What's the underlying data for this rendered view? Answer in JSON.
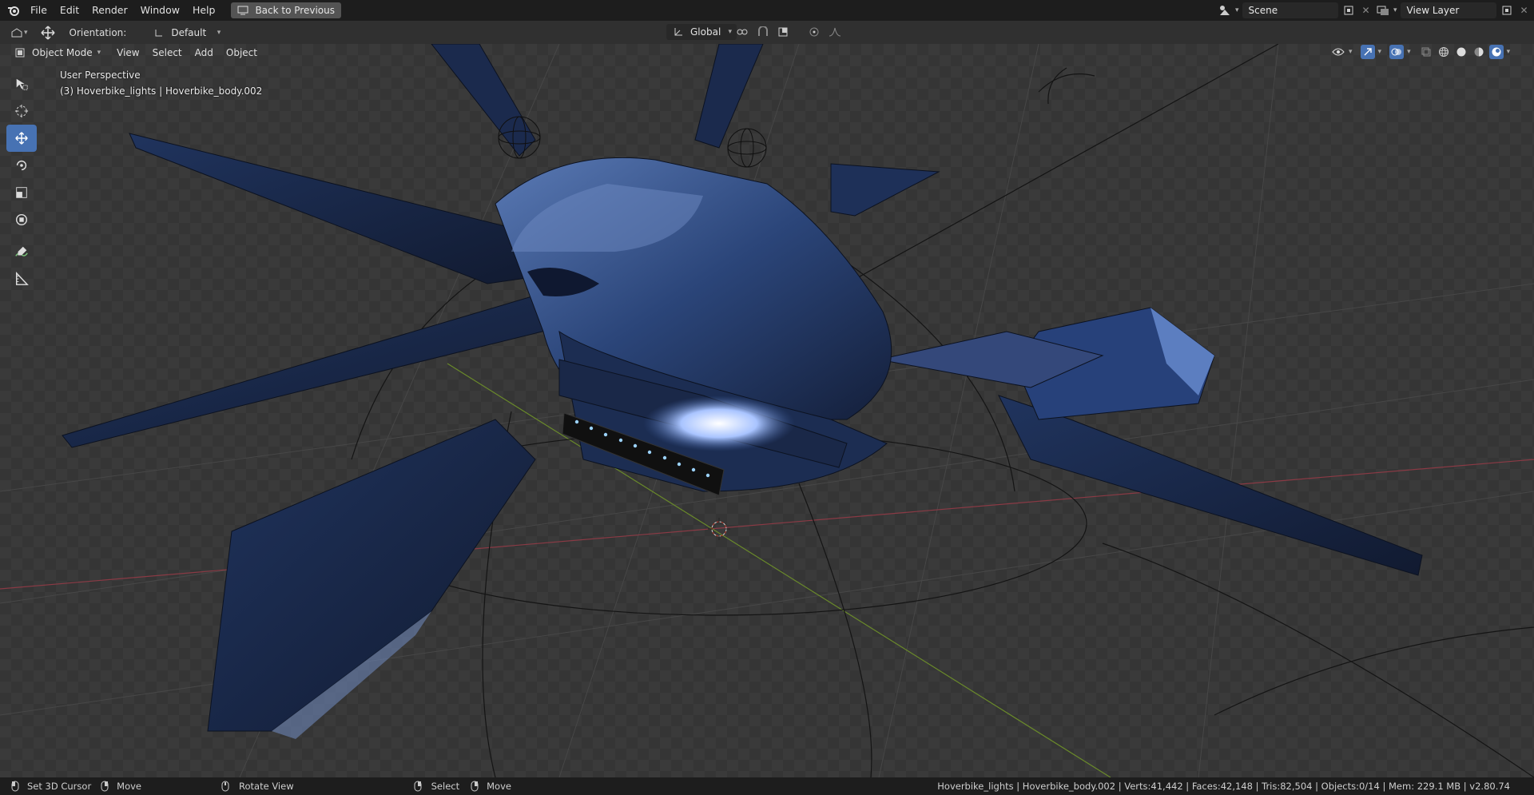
{
  "menu": {
    "file": "File",
    "edit": "Edit",
    "render": "Render",
    "window": "Window",
    "help": "Help",
    "back_to_previous": "Back to Previous"
  },
  "scene": {
    "name": "Scene",
    "view_layer": "View Layer"
  },
  "toolsettings": {
    "orientation_label": "Orientation:",
    "orientation_value": "Default",
    "transform_orientation": "Global"
  },
  "viewport_header": {
    "mode": "Object Mode",
    "view": "View",
    "select": "Select",
    "add": "Add",
    "object": "Object"
  },
  "viewport_info": {
    "perspective": "User Perspective",
    "active": "(3) Hoverbike_lights | Hoverbike_body.002"
  },
  "tools": [
    "select-box",
    "cursor",
    "move",
    "rotate",
    "scale",
    "transform",
    "annotate",
    "measure"
  ],
  "statusbar": {
    "set_cursor": "Set 3D Cursor",
    "move1": "Move",
    "rotate_view": "Rotate View",
    "select": "Select",
    "move2": "Move",
    "stats": "Hoverbike_lights | Hoverbike_body.002 | Verts:41,442 | Faces:42,148 | Tris:82,504 | Objects:0/14 | Mem: 229.1 MB | v2.80.74"
  },
  "colors": {
    "accent": "#4772b3",
    "header": "#1d1d1d",
    "viewport_bg": "#393939"
  }
}
